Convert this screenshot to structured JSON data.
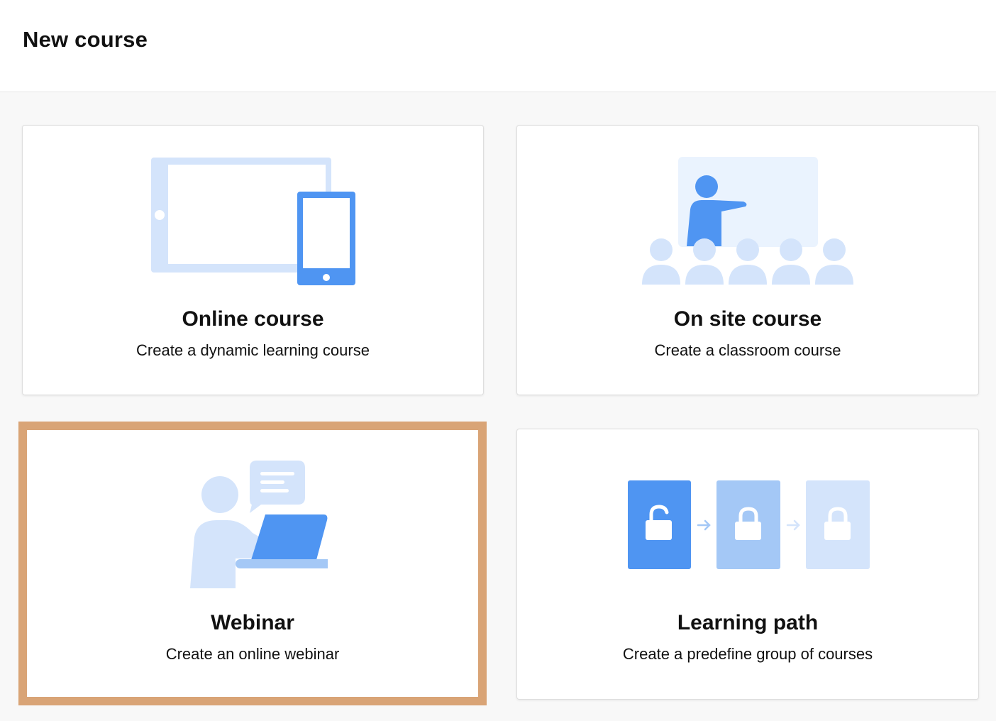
{
  "header": {
    "title": "New course"
  },
  "cards": [
    {
      "title": "Online course",
      "description": "Create a dynamic learning course",
      "icon": "devices-icon"
    },
    {
      "title": "On site course",
      "description": "Create a classroom course",
      "icon": "classroom-icon"
    },
    {
      "title": "Webinar",
      "description": "Create an online webinar",
      "icon": "webinar-icon",
      "selected": true
    },
    {
      "title": "Learning path",
      "description": "Create a predefine group of courses",
      "icon": "learning-path-icon"
    }
  ],
  "colors": {
    "primary": "#4f95f2",
    "light": "#d4e4fb",
    "medium": "#a4c8f6",
    "panel": "#eaf3fe",
    "selection": "#d9a476"
  }
}
